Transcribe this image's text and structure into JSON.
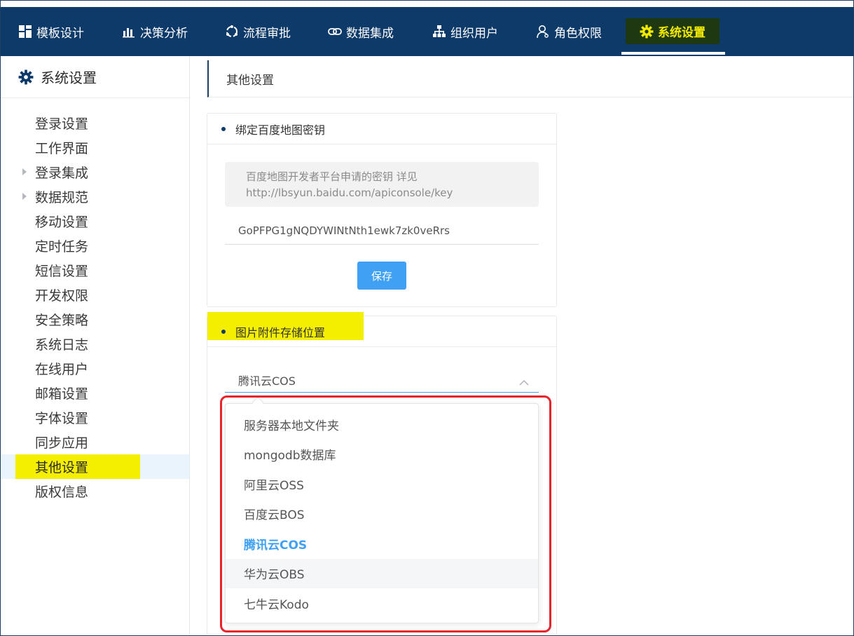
{
  "topnav": {
    "items": [
      {
        "label": "模板设计",
        "icon": "grid-icon"
      },
      {
        "label": "决策分析",
        "icon": "bar-chart-icon"
      },
      {
        "label": "流程审批",
        "icon": "cycle-icon"
      },
      {
        "label": "数据集成",
        "icon": "link-icon"
      },
      {
        "label": "组织用户",
        "icon": "org-tree-icon"
      },
      {
        "label": "角色权限",
        "icon": "user-icon"
      },
      {
        "label": "系统设置",
        "icon": "gear-icon",
        "active": true
      }
    ]
  },
  "sidebar": {
    "title": "系统设置",
    "items": [
      {
        "label": "登录设置"
      },
      {
        "label": "工作界面"
      },
      {
        "label": "登录集成",
        "expandable": true
      },
      {
        "label": "数据规范",
        "expandable": true
      },
      {
        "label": "移动设置"
      },
      {
        "label": "定时任务"
      },
      {
        "label": "短信设置"
      },
      {
        "label": "开发权限"
      },
      {
        "label": "安全策略"
      },
      {
        "label": "系统日志"
      },
      {
        "label": "在线用户"
      },
      {
        "label": "邮箱设置"
      },
      {
        "label": "字体设置"
      },
      {
        "label": "同步应用"
      },
      {
        "label": "其他设置",
        "active": true
      },
      {
        "label": "版权信息"
      }
    ]
  },
  "page": {
    "title": "其他设置"
  },
  "baidu_card": {
    "title": "绑定百度地图密钥",
    "tip_line1": "百度地图开发者平台申请的密钥 详见",
    "tip_line2": "http://lbsyun.baidu.com/apiconsole/key",
    "key_value": "GoPFPG1gNQDYWINtNth1ewk7zk0veRrs",
    "save_label": "保存"
  },
  "storage_card": {
    "title": "图片附件存储位置",
    "selected_value": "腾讯云COS",
    "options": [
      {
        "label": "服务器本地文件夹"
      },
      {
        "label": "mongodb数据库"
      },
      {
        "label": "阿里云OSS"
      },
      {
        "label": "百度云BOS"
      },
      {
        "label": "腾讯云COS",
        "selected": true
      },
      {
        "label": "华为云OBS",
        "hover": true
      },
      {
        "label": "七牛云Kodo"
      }
    ]
  },
  "colors": {
    "nav_bg": "#0e3a69",
    "accent": "#3fa0f4",
    "highlight": "#f4ef00",
    "annotation_red": "#e8232b"
  }
}
